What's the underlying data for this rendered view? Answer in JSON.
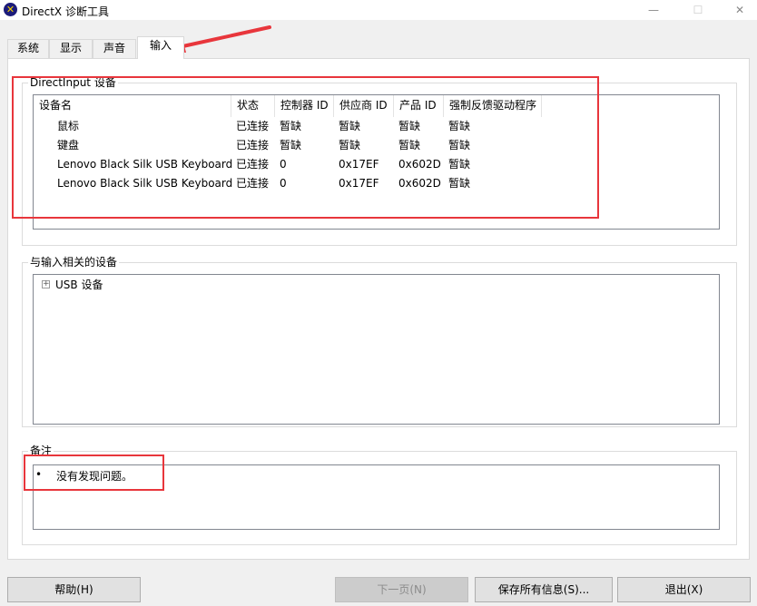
{
  "window": {
    "title": "DirectX 诊断工具",
    "icon": "directx-icon",
    "controls": {
      "minimize": "—",
      "maximize": "☐",
      "close": "✕"
    }
  },
  "tabs": [
    {
      "label": "系统",
      "active": false
    },
    {
      "label": "显示",
      "active": false
    },
    {
      "label": "声音",
      "active": false
    },
    {
      "label": "输入",
      "active": true
    }
  ],
  "directinput": {
    "title": "DirectInput 设备",
    "columns": [
      "设备名",
      "状态",
      "控制器 ID",
      "供应商 ID",
      "产品 ID",
      "强制反馈驱动程序"
    ],
    "rows": [
      [
        "鼠标",
        "已连接",
        "暂缺",
        "暂缺",
        "暂缺",
        "暂缺"
      ],
      [
        "键盘",
        "已连接",
        "暂缺",
        "暂缺",
        "暂缺",
        "暂缺"
      ],
      [
        "Lenovo Black Silk USB Keyboard",
        "已连接",
        "0",
        "0x17EF",
        "0x602D",
        "暂缺"
      ],
      [
        "Lenovo Black Silk USB Keyboard",
        "已连接",
        "0",
        "0x17EF",
        "0x602D",
        "暂缺"
      ]
    ]
  },
  "related_devices": {
    "title": "与输入相关的设备",
    "tree": [
      {
        "expander": "+",
        "label": "USB 设备"
      }
    ]
  },
  "notes": {
    "title": "备注",
    "items": [
      "没有发现问题。"
    ]
  },
  "buttons": {
    "help": "帮助(H)",
    "next": "下一页(N)",
    "save": "保存所有信息(S)...",
    "exit": "退出(X)"
  },
  "accent_color": "#e8363c"
}
